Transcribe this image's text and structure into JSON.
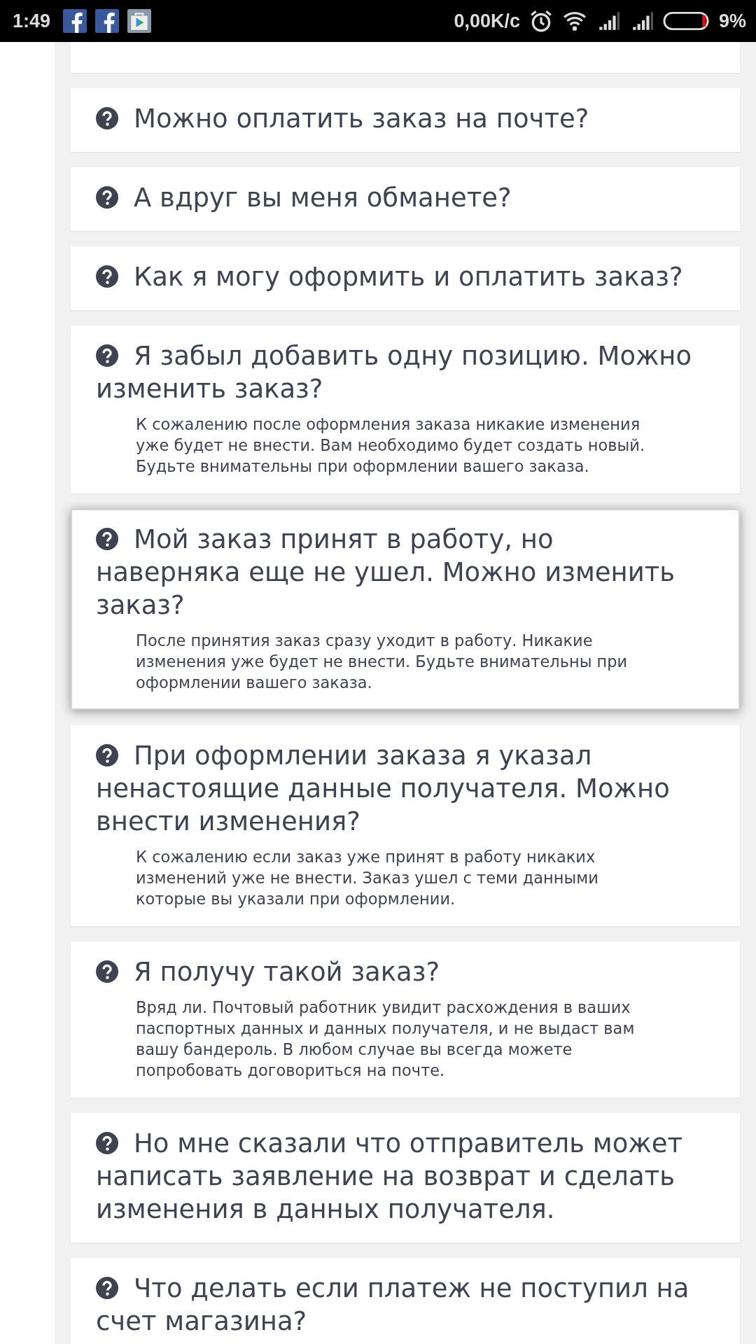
{
  "status_bar": {
    "time": "1:49",
    "speed": "0,00K/с",
    "battery": "9%"
  },
  "faq": [
    {
      "question": "Можно оплатить заказ на почте?",
      "highlighted": false
    },
    {
      "question": "А вдруг вы меня обманете?",
      "highlighted": false
    },
    {
      "question": "Как я могу оформить и оплатить заказ?",
      "highlighted": false
    },
    {
      "question": "Я забыл добавить одну позицию. Можно изменить заказ?",
      "highlighted": false,
      "answer": "К сожалению после оформления заказа никакие изменения уже будет не внести. Вам необходимо будет создать новый. Будьте внимательны при оформлении вашего заказа."
    },
    {
      "question": "Мой заказ принят в работу, но наверняка еще не ушел. Можно изменить заказ?",
      "highlighted": true,
      "answer": "После принятия заказ сразу уходит в работу. Никакие изменения уже будет не внести. Будьте внимательны при оформлении вашего заказа."
    },
    {
      "question": "При оформлении заказа я указал ненастоящие данные получателя. Можно внести изменения?",
      "highlighted": false,
      "answer": "К сожалению если заказ уже принят в работу никаких изменений уже не внести. Заказ ушел с теми данными которые вы указали при оформлении."
    },
    {
      "question": "Я получу такой заказ?",
      "highlighted": false,
      "answer": "Вряд ли. Почтовый работник увидит расхождения в ваших паспортных данных и данных получателя, и не выдаст вам вашу бандероль. В любом случае вы всегда можете попробовать договориться на почте."
    },
    {
      "question": "Но мне сказали что отправитель может написать заявление на возврат и сделать изменения в данных получателя.",
      "highlighted": false
    },
    {
      "question": "Что делать если платеж не поступил на счет магазина?",
      "highlighted": false
    }
  ]
}
